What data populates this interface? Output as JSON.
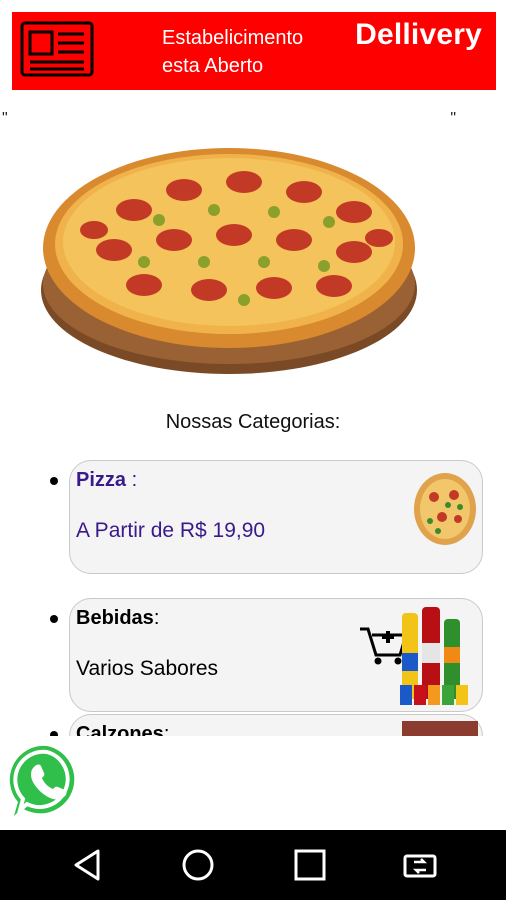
{
  "header": {
    "icon": "newspaper-icon",
    "status_line1": "Estabelicimento",
    "status_line2": "esta Aberto",
    "brand": "Dellivery",
    "background": "#ff0000"
  },
  "hero": {
    "image": "pepperoni-pizza-image",
    "quote_left": "\"",
    "quote_right": "\""
  },
  "categories_title": "Nossas Categorias:",
  "categories": [
    {
      "name": "Pizza",
      "separator": " :",
      "subtitle": "A Partir de R$ 19,90",
      "thumb": "pizza-thumbnail",
      "text_color": "#3a1a8a"
    },
    {
      "name": "Bebidas",
      "separator": ":",
      "subtitle": "Varios Sabores",
      "thumb": "drinks-with-cart-thumbnail"
    },
    {
      "name": "Calzones",
      "separator": ":",
      "subtitle": "",
      "thumb": "calzone-thumbnail"
    }
  ],
  "floating": {
    "icon": "whatsapp-icon"
  },
  "navbar": {
    "back": "back-triangle-icon",
    "home": "home-circle-icon",
    "recents": "recents-square-icon",
    "rotate": "rotate-screen-icon"
  }
}
